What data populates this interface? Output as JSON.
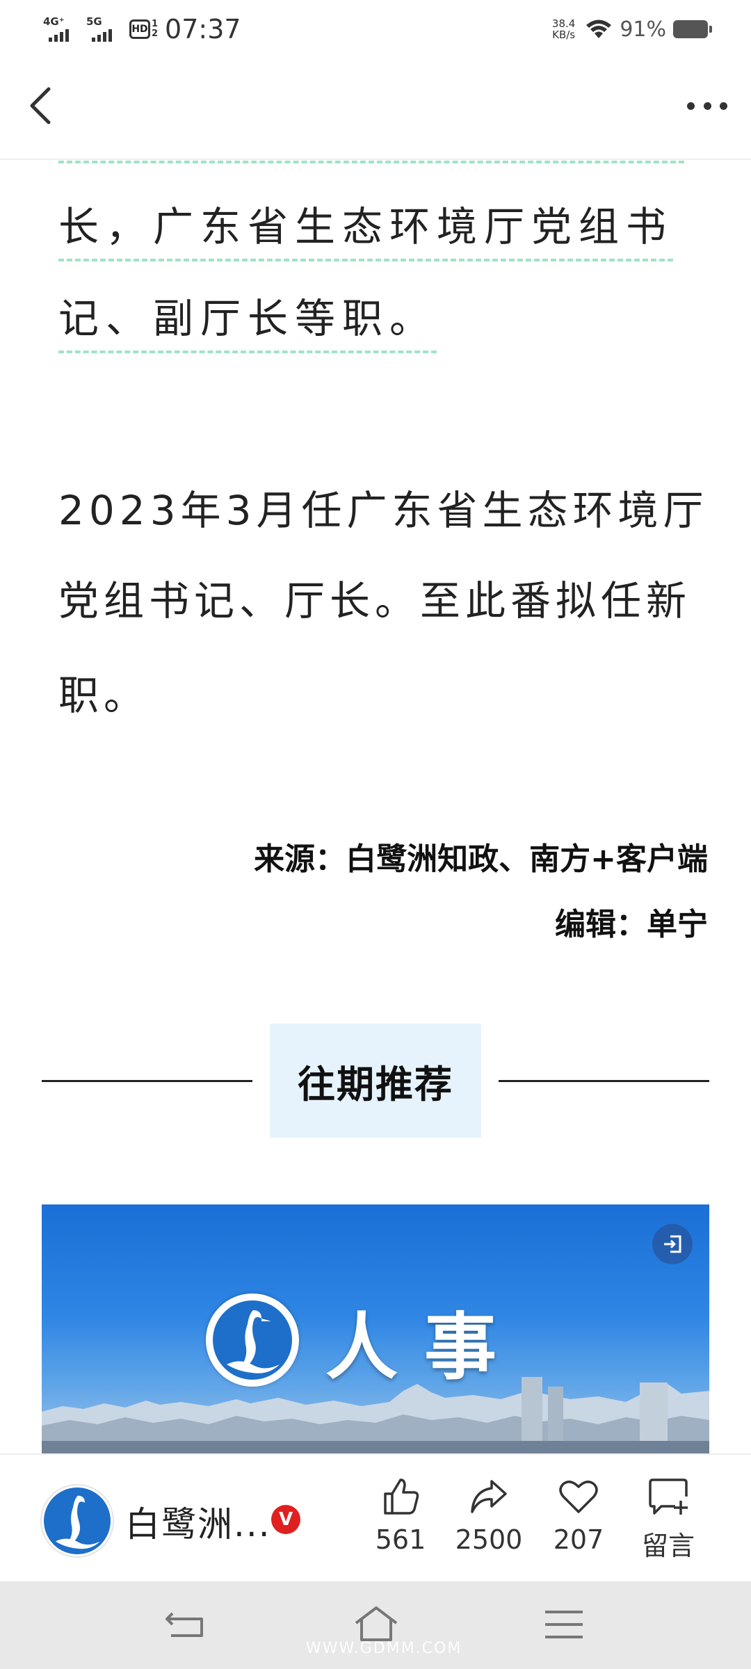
{
  "status_bar": {
    "network_1": "4G⁺",
    "network_2": "5G",
    "hd_label": "HD",
    "hd_sub_1": "1",
    "hd_sub_2": "2",
    "time": "07:37",
    "net_speed_value": "38.4",
    "net_speed_unit": "KB/s",
    "battery": "91%",
    "battery_level": 0.91
  },
  "nav": {
    "back_icon": "chevron-left-icon",
    "more_icon": "more-dots-icon"
  },
  "article": {
    "quote_line_1": "长，广东省生态环境厅党组书",
    "quote_line_2": "记、副厅长等职。",
    "para_line_1": "2023年3月任广东省生态环境厅",
    "para_line_2": "党组书记、厅长。至此番拟任新",
    "para_line_3": "职。",
    "source": "来源：白鹭洲知政、南方+客户端",
    "editor": "编辑：单宁"
  },
  "recommend": {
    "heading": "往期推荐",
    "banner_title": "人事",
    "open_icon": "open-external-icon"
  },
  "action_bar": {
    "account_name": "白鹭洲...",
    "verified_badge": "V",
    "likes": "561",
    "shares": "2500",
    "favorites": "207",
    "comment_label": "留言"
  },
  "system_nav": {
    "watermark": "WWW.GDMM.COM"
  },
  "colors": {
    "dash_accent": "#9ee3c5",
    "heading_bg": "#e6f3fc",
    "banner_blue": "#1b6fd6",
    "verified_red": "#e02020"
  }
}
